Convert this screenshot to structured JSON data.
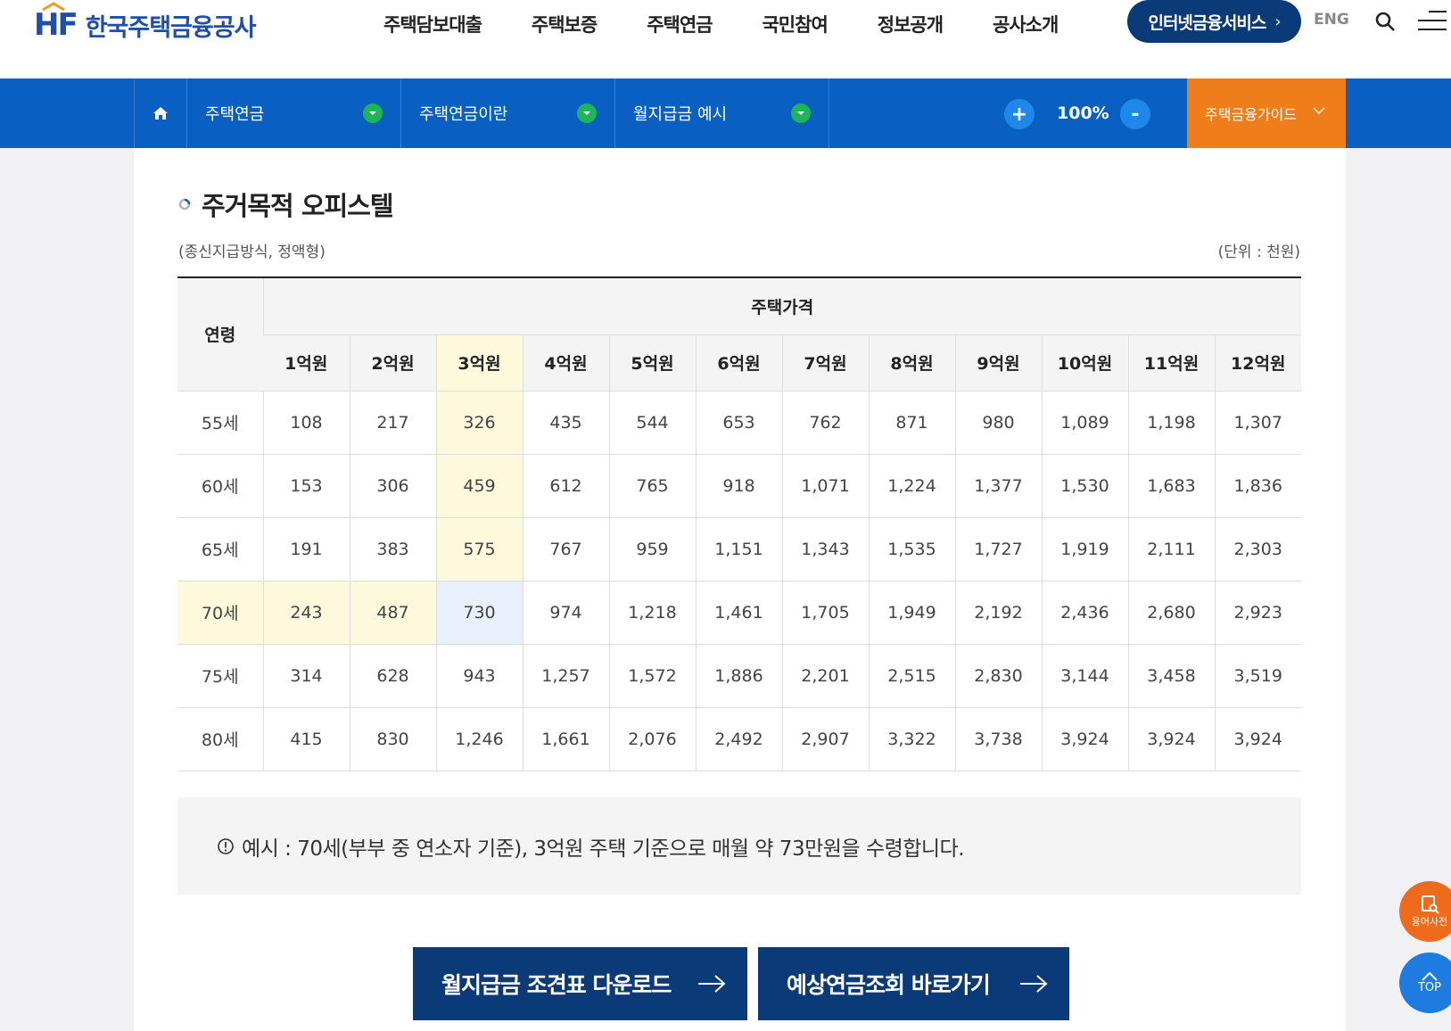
{
  "header": {
    "logo_mark": "HF",
    "logo_text": "한국주택금융공사",
    "nav": [
      "주택담보대출",
      "주택보증",
      "주택연금",
      "국민참여",
      "정보공개",
      "공사소개"
    ],
    "internet_service": "인터넷금융서비스",
    "lang": "ENG"
  },
  "breadcrumb": {
    "items": [
      "주택연금",
      "주택연금이란",
      "월지급금 예시"
    ],
    "zoom": "100%",
    "zoom_plus": "+",
    "zoom_minus": "-",
    "guide": "주택금융가이드"
  },
  "section": {
    "title": "주거목적 오피스텔",
    "subtitle": "(종신지급방식, 정액형)",
    "unit": "(단위 : 천원)"
  },
  "table": {
    "age_header": "연령",
    "price_header": "주택가격",
    "columns": [
      "1억원",
      "2억원",
      "3억원",
      "4억원",
      "5억원",
      "6억원",
      "7억원",
      "8억원",
      "9억원",
      "10억원",
      "11억원",
      "12억원"
    ],
    "rows": [
      {
        "age": "55세",
        "values": [
          "108",
          "217",
          "326",
          "435",
          "544",
          "653",
          "762",
          "871",
          "980",
          "1,089",
          "1,198",
          "1,307"
        ]
      },
      {
        "age": "60세",
        "values": [
          "153",
          "306",
          "459",
          "612",
          "765",
          "918",
          "1,071",
          "1,224",
          "1,377",
          "1,530",
          "1,683",
          "1,836"
        ]
      },
      {
        "age": "65세",
        "values": [
          "191",
          "383",
          "575",
          "767",
          "959",
          "1,151",
          "1,343",
          "1,535",
          "1,727",
          "1,919",
          "2,111",
          "2,303"
        ]
      },
      {
        "age": "70세",
        "values": [
          "243",
          "487",
          "730",
          "974",
          "1,218",
          "1,461",
          "1,705",
          "1,949",
          "2,192",
          "2,436",
          "2,680",
          "2,923"
        ]
      },
      {
        "age": "75세",
        "values": [
          "314",
          "628",
          "943",
          "1,257",
          "1,572",
          "1,886",
          "2,201",
          "2,515",
          "2,830",
          "3,144",
          "3,458",
          "3,519"
        ]
      },
      {
        "age": "80세",
        "values": [
          "415",
          "830",
          "1,246",
          "1,661",
          "2,076",
          "2,492",
          "2,907",
          "3,322",
          "3,738",
          "3,924",
          "3,924",
          "3,924"
        ]
      }
    ],
    "highlight_row": 3,
    "highlight_col": 2,
    "colors": {
      "highlight_yellow": "#fdf9dd",
      "highlight_blue": "#e8f0fc"
    }
  },
  "example": {
    "text": "예시 : 70세(부부 중 연소자 기준), 3억원 주택 기준으로 매월 약 73만원을 수령합니다."
  },
  "buttons": {
    "download": "월지급금 조견표 다운로드",
    "inquiry": "예상연금조회 바로가기"
  },
  "floating": {
    "dictionary": "용어사전",
    "top": "TOP"
  },
  "colors": {
    "brand_blue": "#0a5fc2",
    "dark_navy": "#0b3a78",
    "orange": "#ef7d1a",
    "green": "#1fb35a"
  }
}
